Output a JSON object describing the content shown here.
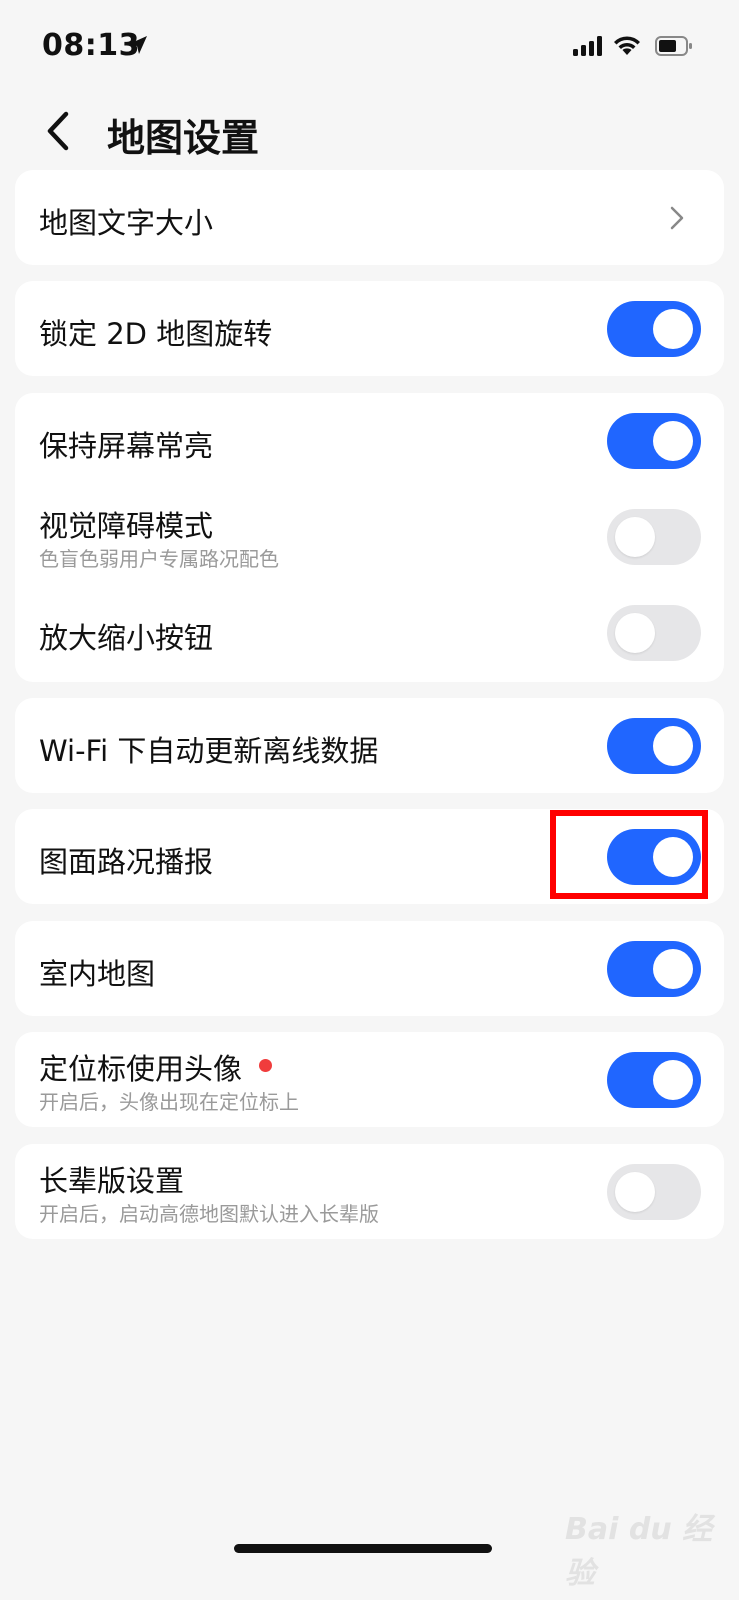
{
  "status": {
    "time": "08:13"
  },
  "nav": {
    "title": "地图设置"
  },
  "cards": {
    "text_size": {
      "label": "地图文字大小"
    },
    "lock_2d": {
      "label": "锁定 2D 地图旋转",
      "on": true
    },
    "keep_screen_on": {
      "label": "保持屏幕常亮",
      "on": true
    },
    "visual_impair": {
      "label": "视觉障碍模式",
      "sub": "色盲色弱用户专属路况配色",
      "on": false
    },
    "zoom_buttons": {
      "label": "放大缩小按钮",
      "on": false
    },
    "wifi_update": {
      "label": "Wi-Fi 下自动更新离线数据",
      "on": true
    },
    "traffic_broadcast": {
      "label": "图面路况播报",
      "on": true
    },
    "indoor_map": {
      "label": "室内地图",
      "on": true
    },
    "avatar_marker": {
      "label": "定位标使用头像",
      "sub": "开启后，头像出现在定位标上",
      "on": true
    },
    "elder_mode": {
      "label": "长辈版设置",
      "sub": "开启后，启动高德地图默认进入长辈版",
      "on": false
    }
  },
  "colors": {
    "toggle_on": "#2066ff",
    "toggle_off": "#e6e6e8",
    "highlight": "#ff0000",
    "badge": "#f03c3c"
  },
  "watermark": "Bai du 经验"
}
